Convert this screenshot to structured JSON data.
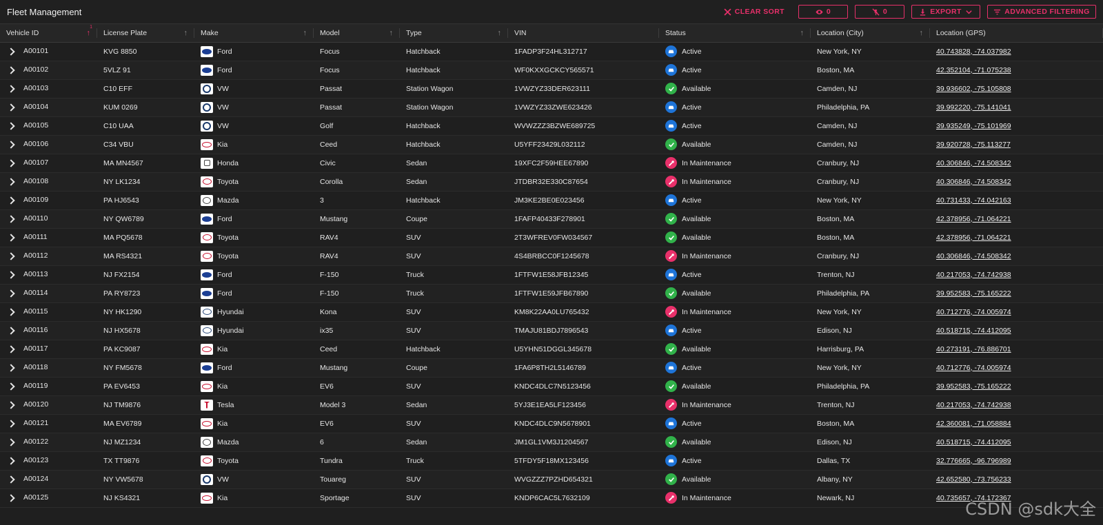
{
  "app": {
    "title": "Fleet Management"
  },
  "toolbar": {
    "clear_sort": "CLEAR SORT",
    "visible_count": "0",
    "hidden_count": "0",
    "export": "EXPORT",
    "advanced_filtering": "ADVANCED FILTERING"
  },
  "columns": [
    "Vehicle ID",
    "License Plate",
    "Make",
    "Model",
    "Type",
    "VIN",
    "Status",
    "Location (City)",
    "Location (GPS)"
  ],
  "sort_badge": "1",
  "colors": {
    "accent": "#e8306a",
    "active": "#1e74d8",
    "available": "#31b24a",
    "maintenance": "#e8306a"
  },
  "rows": [
    {
      "id": "A00101",
      "plate": "KVG 8850",
      "make": "Ford",
      "model": "Focus",
      "type": "Hatchback",
      "vin": "1FADP3F24HL312717",
      "status": "Active",
      "city": "New York, NY",
      "gps": "40.743828, -74.037982"
    },
    {
      "id": "A00102",
      "plate": "5VLZ 91",
      "make": "Ford",
      "model": "Focus",
      "type": "Hatchback",
      "vin": "WF0KXXGCKCY565571",
      "status": "Active",
      "city": "Boston, MA",
      "gps": "42.352104, -71.075238"
    },
    {
      "id": "A00103",
      "plate": "C10 EFF",
      "make": "VW",
      "model": "Passat",
      "type": "Station Wagon",
      "vin": "1VWZYZ33DER623111",
      "status": "Available",
      "city": "Camden, NJ",
      "gps": "39.936602, -75.105808"
    },
    {
      "id": "A00104",
      "plate": "KUM 0269",
      "make": "VW",
      "model": "Passat",
      "type": "Station Wagon",
      "vin": "1VWZYZ33ZWE623426",
      "status": "Active",
      "city": "Philadelphia, PA",
      "gps": "39.992220, -75.141041"
    },
    {
      "id": "A00105",
      "plate": "C10 UAA",
      "make": "VW",
      "model": "Golf",
      "type": "Hatchback",
      "vin": "WVWZZZ3BZWE689725",
      "status": "Active",
      "city": "Camden, NJ",
      "gps": "39.935249, -75.101969"
    },
    {
      "id": "A00106",
      "plate": "C34 VBU",
      "make": "Kia",
      "model": "Ceed",
      "type": "Hatchback",
      "vin": "U5YFF23429L032112",
      "status": "Available",
      "city": "Camden, NJ",
      "gps": "39.920728, -75.113277"
    },
    {
      "id": "A00107",
      "plate": "MA MN4567",
      "make": "Honda",
      "model": "Civic",
      "type": "Sedan",
      "vin": "19XFC2F59HEE67890",
      "status": "In Maintenance",
      "city": "Cranbury, NJ",
      "gps": "40.306846, -74.508342"
    },
    {
      "id": "A00108",
      "plate": "NY LK1234",
      "make": "Toyota",
      "model": "Corolla",
      "type": "Sedan",
      "vin": "JTDBR32E330C87654",
      "status": "In Maintenance",
      "city": "Cranbury, NJ",
      "gps": "40.306846, -74.508342"
    },
    {
      "id": "A00109",
      "plate": "PA HJ6543",
      "make": "Mazda",
      "model": "3",
      "type": "Hatchback",
      "vin": "JM3KE2BE0E023456",
      "status": "Active",
      "city": "New York, NY",
      "gps": "40.731433, -74.042163"
    },
    {
      "id": "A00110",
      "plate": "NY QW6789",
      "make": "Ford",
      "model": "Mustang",
      "type": "Coupe",
      "vin": "1FAFP40433F278901",
      "status": "Available",
      "city": "Boston, MA",
      "gps": "42.378956, -71.064221"
    },
    {
      "id": "A00111",
      "plate": "MA PQ5678",
      "make": "Toyota",
      "model": "RAV4",
      "type": "SUV",
      "vin": "2T3WFREV0FW034567",
      "status": "Available",
      "city": "Boston, MA",
      "gps": "42.378956, -71.064221"
    },
    {
      "id": "A00112",
      "plate": "MA RS4321",
      "make": "Toyota",
      "model": "RAV4",
      "type": "SUV",
      "vin": "4S4BRBCC0F1245678",
      "status": "In Maintenance",
      "city": "Cranbury, NJ",
      "gps": "40.306846, -74.508342"
    },
    {
      "id": "A00113",
      "plate": "NJ FX2154",
      "make": "Ford",
      "model": "F-150",
      "type": "Truck",
      "vin": "1FTFW1E58JFB12345",
      "status": "Active",
      "city": "Trenton, NJ",
      "gps": "40.217053, -74.742938"
    },
    {
      "id": "A00114",
      "plate": "PA RY8723",
      "make": "Ford",
      "model": "F-150",
      "type": "Truck",
      "vin": "1FTFW1E59JFB67890",
      "status": "Available",
      "city": "Philadelphia, PA",
      "gps": "39.952583, -75.165222"
    },
    {
      "id": "A00115",
      "plate": "NY HK1290",
      "make": "Hyundai",
      "model": "Kona",
      "type": "SUV",
      "vin": "KM8K22AA0LU765432",
      "status": "In Maintenance",
      "city": "New York, NY",
      "gps": "40.712776, -74.005974"
    },
    {
      "id": "A00116",
      "plate": "NJ HX5678",
      "make": "Hyundai",
      "model": "ix35",
      "type": "SUV",
      "vin": "TMAJU81BDJ7896543",
      "status": "Active",
      "city": "Edison, NJ",
      "gps": "40.518715, -74.412095"
    },
    {
      "id": "A00117",
      "plate": "PA KC9087",
      "make": "Kia",
      "model": "Ceed",
      "type": "Hatchback",
      "vin": "U5YHN51DGGL345678",
      "status": "Available",
      "city": "Harrisburg, PA",
      "gps": "40.273191, -76.886701"
    },
    {
      "id": "A00118",
      "plate": "NY FM5678",
      "make": "Ford",
      "model": "Mustang",
      "type": "Coupe",
      "vin": "1FA6P8TH2L5146789",
      "status": "Active",
      "city": "New York, NY",
      "gps": "40.712776, -74.005974"
    },
    {
      "id": "A00119",
      "plate": "PA EV6453",
      "make": "Kia",
      "model": "EV6",
      "type": "SUV",
      "vin": "KNDC4DLC7N5123456",
      "status": "Available",
      "city": "Philadelphia, PA",
      "gps": "39.952583, -75.165222"
    },
    {
      "id": "A00120",
      "plate": "NJ TM9876",
      "make": "Tesla",
      "model": "Model 3",
      "type": "Sedan",
      "vin": "5YJ3E1EA5LF123456",
      "status": "In Maintenance",
      "city": "Trenton, NJ",
      "gps": "40.217053, -74.742938"
    },
    {
      "id": "A00121",
      "plate": "MA EV6789",
      "make": "Kia",
      "model": "EV6",
      "type": "SUV",
      "vin": "KNDC4DLC9N5678901",
      "status": "Active",
      "city": "Boston, MA",
      "gps": "42.360081, -71.058884"
    },
    {
      "id": "A00122",
      "plate": "NJ MZ1234",
      "make": "Mazda",
      "model": "6",
      "type": "Sedan",
      "vin": "JM1GL1VM3J1204567",
      "status": "Available",
      "city": "Edison, NJ",
      "gps": "40.518715, -74.412095"
    },
    {
      "id": "A00123",
      "plate": "TX TT9876",
      "make": "Toyota",
      "model": "Tundra",
      "type": "Truck",
      "vin": "5TFDY5F18MX123456",
      "status": "Active",
      "city": "Dallas, TX",
      "gps": "32.776665, -96.796989"
    },
    {
      "id": "A00124",
      "plate": "NY VW5678",
      "make": "VW",
      "model": "Touareg",
      "type": "SUV",
      "vin": "WVGZZZ7PZHD654321",
      "status": "Available",
      "city": "Albany, NY",
      "gps": "42.652580, -73.756233"
    },
    {
      "id": "A00125",
      "plate": "NJ KS4321",
      "make": "Kia",
      "model": "Sportage",
      "type": "SUV",
      "vin": "KNDP6CAC5L7632109",
      "status": "In Maintenance",
      "city": "Newark, NJ",
      "gps": "40.735657, -74.172367"
    }
  ],
  "watermark": "CSDN @sdk大全"
}
